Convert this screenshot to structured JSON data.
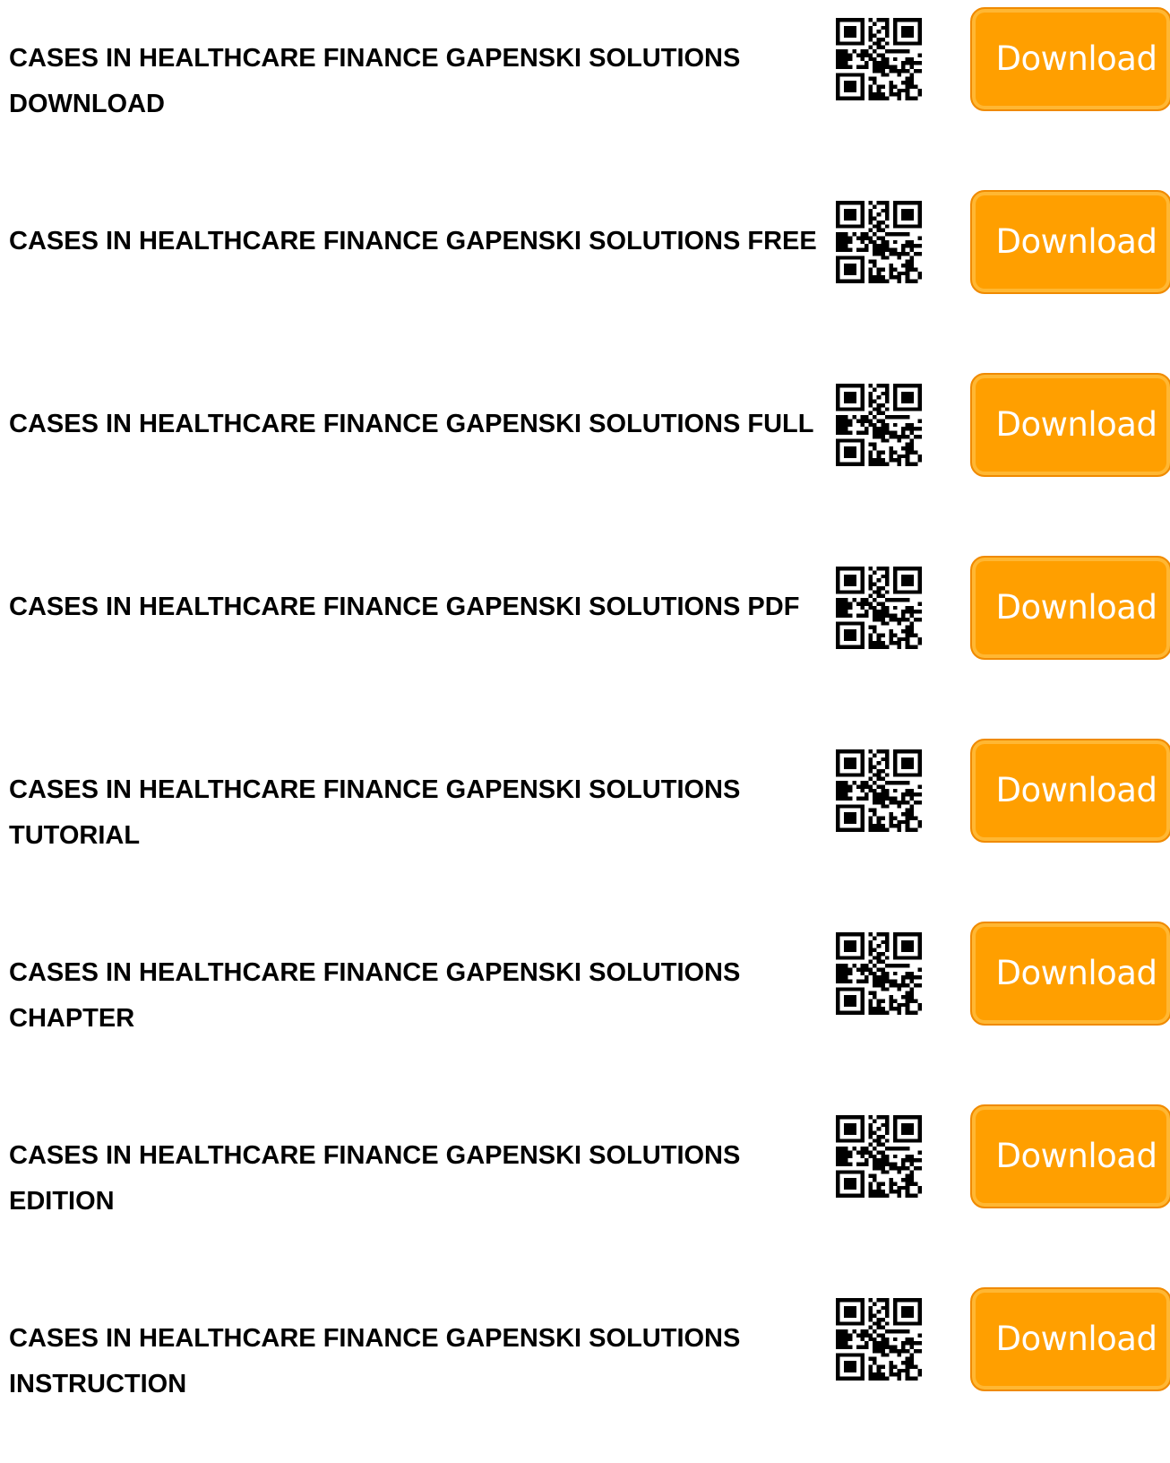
{
  "items": [
    {
      "title": "CASES IN HEALTHCARE FINANCE GAPENSKI SOLUTIONS DOWNLOAD",
      "button_label": "Download"
    },
    {
      "title": "CASES IN HEALTHCARE FINANCE GAPENSKI SOLUTIONS FREE",
      "button_label": "Download"
    },
    {
      "title": "CASES IN HEALTHCARE FINANCE GAPENSKI SOLUTIONS FULL",
      "button_label": "Download"
    },
    {
      "title": "CASES IN HEALTHCARE FINANCE GAPENSKI SOLUTIONS PDF",
      "button_label": "Download"
    },
    {
      "title": "CASES IN HEALTHCARE FINANCE GAPENSKI SOLUTIONS TUTORIAL",
      "button_label": "Download"
    },
    {
      "title": "CASES IN HEALTHCARE FINANCE GAPENSKI SOLUTIONS CHAPTER",
      "button_label": "Download"
    },
    {
      "title": "CASES IN HEALTHCARE FINANCE GAPENSKI SOLUTIONS EDITION",
      "button_label": "Download"
    },
    {
      "title": "CASES IN HEALTHCARE FINANCE GAPENSKI SOLUTIONS INSTRUCTION",
      "button_label": "Download"
    }
  ],
  "colors": {
    "button_fill": "#ff9f00",
    "button_text": "#ffffff",
    "title_text": "#000000"
  },
  "icons": {
    "qr": "qr-code-icon"
  }
}
